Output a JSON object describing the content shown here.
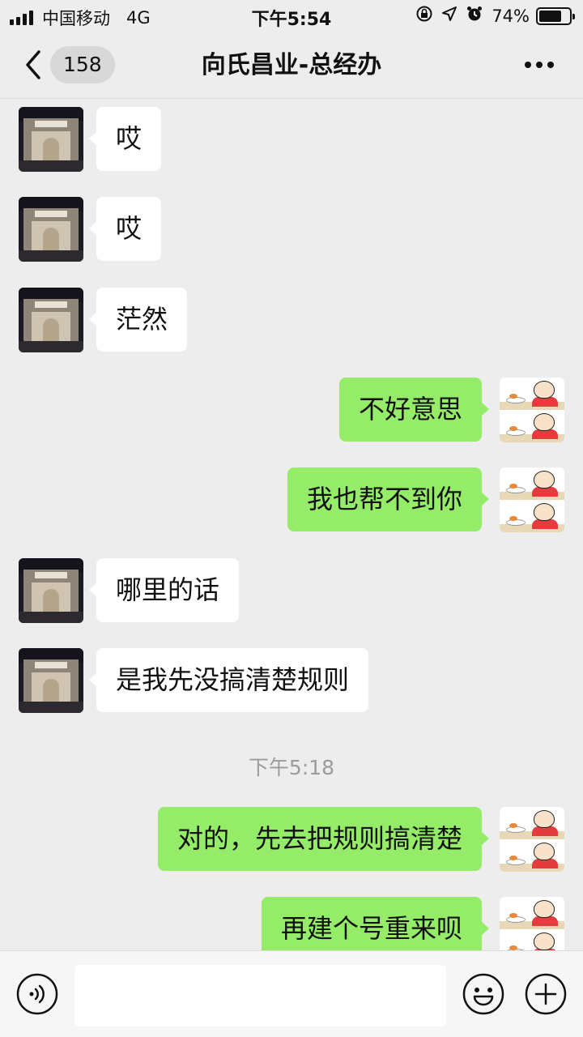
{
  "status_bar": {
    "carrier": "中国移动",
    "network": "4G",
    "time": "下午5:54",
    "battery": "74%",
    "battery_level": 0.74
  },
  "nav": {
    "unread_count": "158",
    "title": "向氏昌业-总经办",
    "back_icon": "chevron-left-icon",
    "more_icon": "more-dots-icon"
  },
  "messages": [
    {
      "side": "left",
      "text": "哎"
    },
    {
      "side": "left",
      "text": "哎"
    },
    {
      "side": "left",
      "text": "茫然"
    },
    {
      "side": "right",
      "text": "不好意思"
    },
    {
      "side": "right",
      "text": "我也帮不到你"
    },
    {
      "side": "left",
      "text": "哪里的话"
    },
    {
      "side": "left",
      "text": "是我先没搞清楚规则"
    },
    {
      "side": "right",
      "text": "对的，先去把规则搞清楚"
    },
    {
      "side": "right",
      "text": "再建个号重来呗"
    }
  ],
  "timestamp": "下午5:18",
  "input_bar": {
    "voice_icon": "voice-icon",
    "emoji_icon": "emoji-icon",
    "plus_icon": "plus-icon",
    "input_value": ""
  },
  "colors": {
    "background": "#ededed",
    "outgoing_bubble": "#95ec69",
    "incoming_bubble": "#ffffff"
  }
}
